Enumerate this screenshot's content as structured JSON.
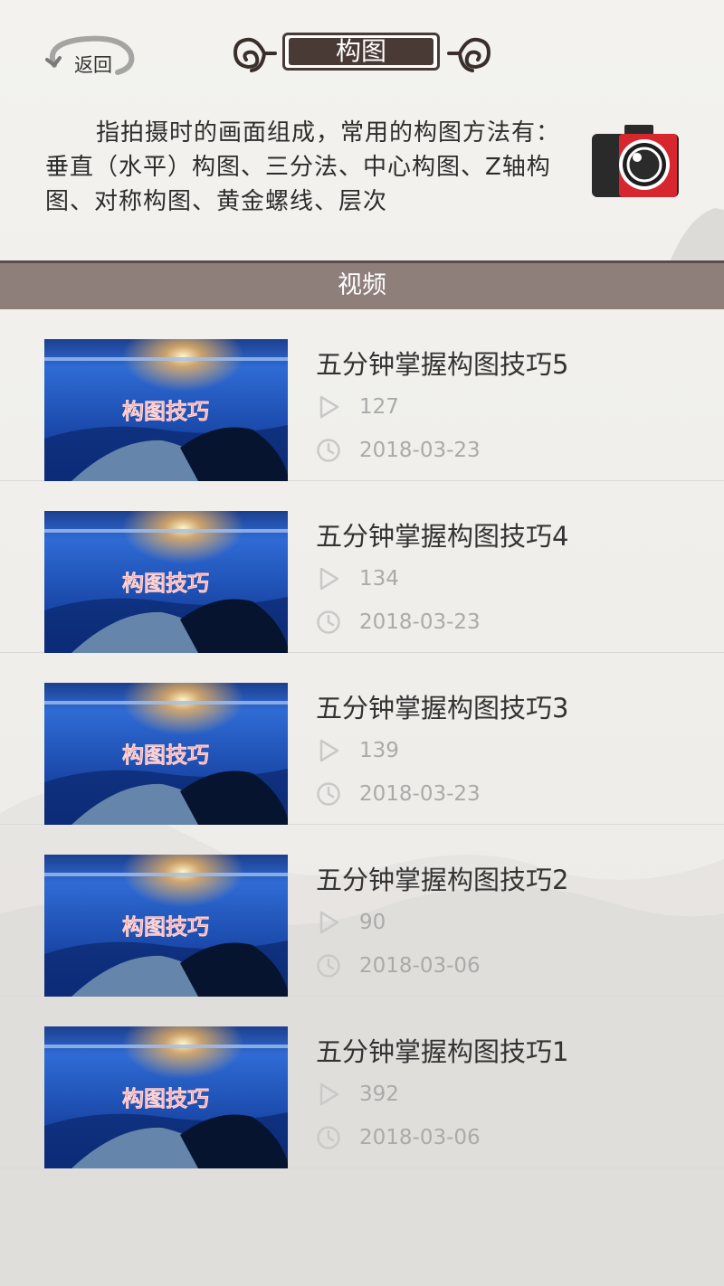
{
  "header": {
    "back_label": "返回",
    "title": "构图"
  },
  "intro": {
    "text": "指拍摄时的画面组成，常用的构图方法有：垂直（水平）构图、三分法、中心构图、Z轴构图、对称构图、黄金螺线、层次"
  },
  "section": {
    "label": "视频"
  },
  "videos": [
    {
      "title": "五分钟掌握构图技巧5",
      "views": "127",
      "date": "2018-03-23",
      "thumb_text": "构图技巧"
    },
    {
      "title": "五分钟掌握构图技巧4",
      "views": "134",
      "date": "2018-03-23",
      "thumb_text": "构图技巧"
    },
    {
      "title": "五分钟掌握构图技巧3",
      "views": "139",
      "date": "2018-03-23",
      "thumb_text": "构图技巧"
    },
    {
      "title": "五分钟掌握构图技巧2",
      "views": "90",
      "date": "2018-03-06",
      "thumb_text": "构图技巧"
    },
    {
      "title": "五分钟掌握构图技巧1",
      "views": "392",
      "date": "2018-03-06",
      "thumb_text": "构图技巧"
    }
  ],
  "colors": {
    "title_bg": "#4a3a35",
    "section_bar": "#8e7f7b",
    "camera_red": "#d8262e"
  }
}
